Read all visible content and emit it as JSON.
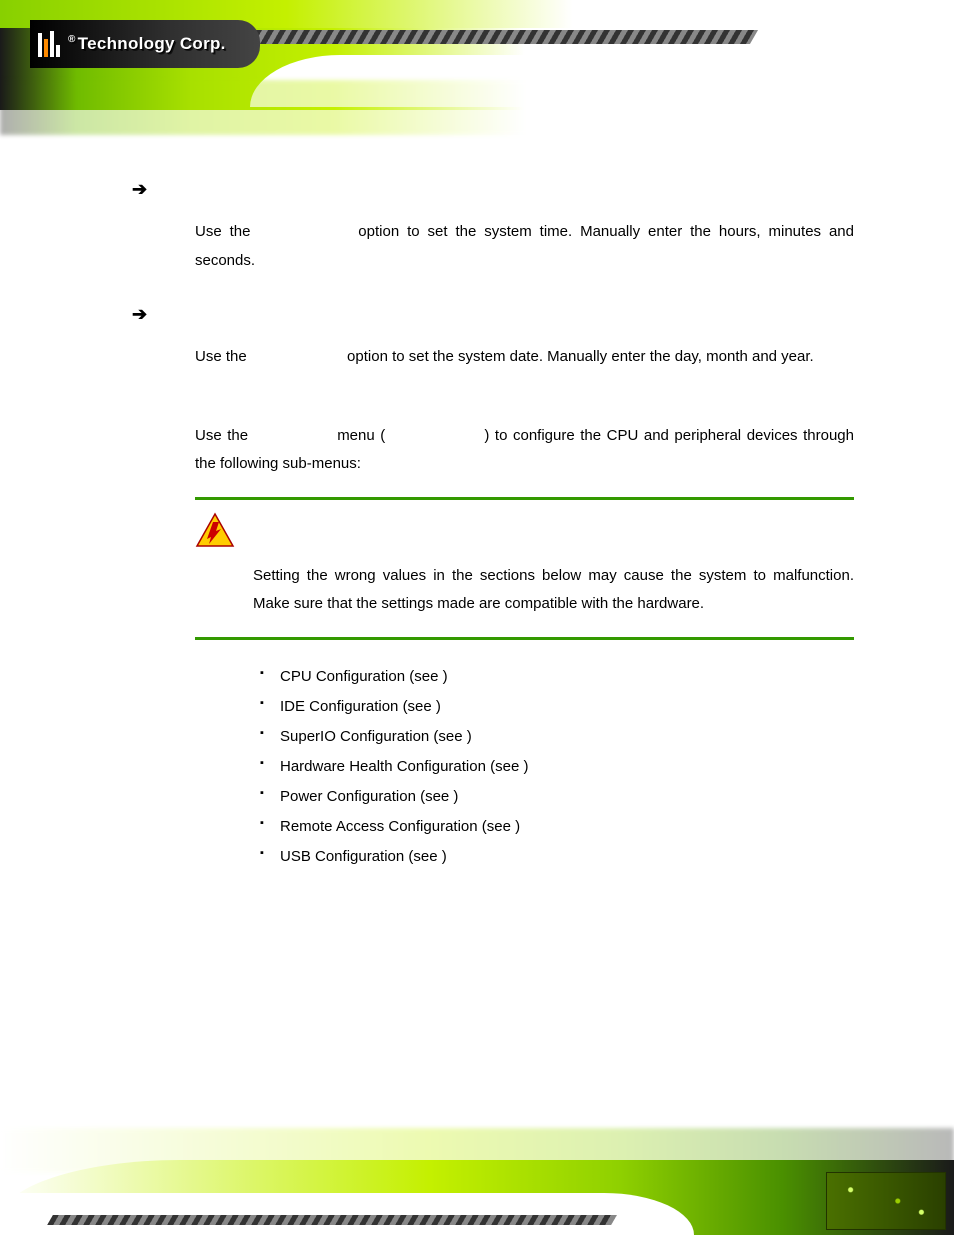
{
  "brand": {
    "registered": "®",
    "name": "Technology Corp."
  },
  "items": {
    "time": {
      "label": "",
      "body_pre": "Use the ",
      "body_post": " option to set the system time. Manually enter the hours, minutes and seconds."
    },
    "date": {
      "label": "",
      "body_pre": "Use the ",
      "body_post": " option to set the system date. Manually enter the day, month and year."
    }
  },
  "section": {
    "intro_pre": "Use the ",
    "intro_mid": " menu ( ",
    "intro_post": " ) to configure the CPU and peripheral devices through the following sub-menus:"
  },
  "warning": {
    "text": "Setting the wrong values in the sections below may cause the system to malfunction. Make sure that the settings made are compatible with the hardware."
  },
  "sublist": [
    "CPU Configuration (see                       )",
    "IDE Configuration (see                      )",
    "SuperIO Configuration (see                         )",
    "Hardware Health Configuration (see                   )",
    "Power Configuration (see                        )",
    "Remote Access Configuration (see                         )",
    "USB Configuration (see                       )"
  ]
}
